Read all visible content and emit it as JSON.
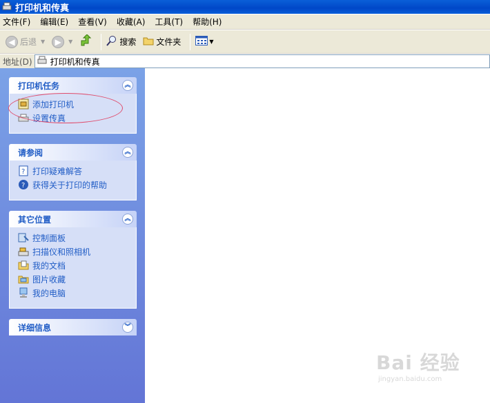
{
  "window": {
    "title": "打印机和传真"
  },
  "menu": [
    "文件(F)",
    "编辑(E)",
    "查看(V)",
    "收藏(A)",
    "工具(T)",
    "帮助(H)"
  ],
  "toolbar": {
    "back_label": "后退",
    "search_label": "搜索",
    "folders_label": "文件夹"
  },
  "address": {
    "label": "地址(D)",
    "value": "打印机和传真"
  },
  "panels": {
    "printer_tasks": {
      "title": "打印机任务",
      "items": [
        "添加打印机",
        "设置传真"
      ]
    },
    "see_also": {
      "title": "请参阅",
      "items": [
        "打印疑难解答",
        "获得关于打印的帮助"
      ]
    },
    "other_places": {
      "title": "其它位置",
      "items": [
        "控制面板",
        "扫描仪和照相机",
        "我的文档",
        "图片收藏",
        "我的电脑"
      ]
    },
    "details": {
      "title": "详细信息"
    }
  },
  "watermark": {
    "brand": "Bai 经验",
    "url": "jingyan.baidu.com"
  },
  "colors": {
    "titlebar": "#0a5fd8",
    "pane_top": "#7ba2e7",
    "pane_bottom": "#6375d6",
    "link": "#215dc6",
    "highlight": "#e04a6a"
  }
}
